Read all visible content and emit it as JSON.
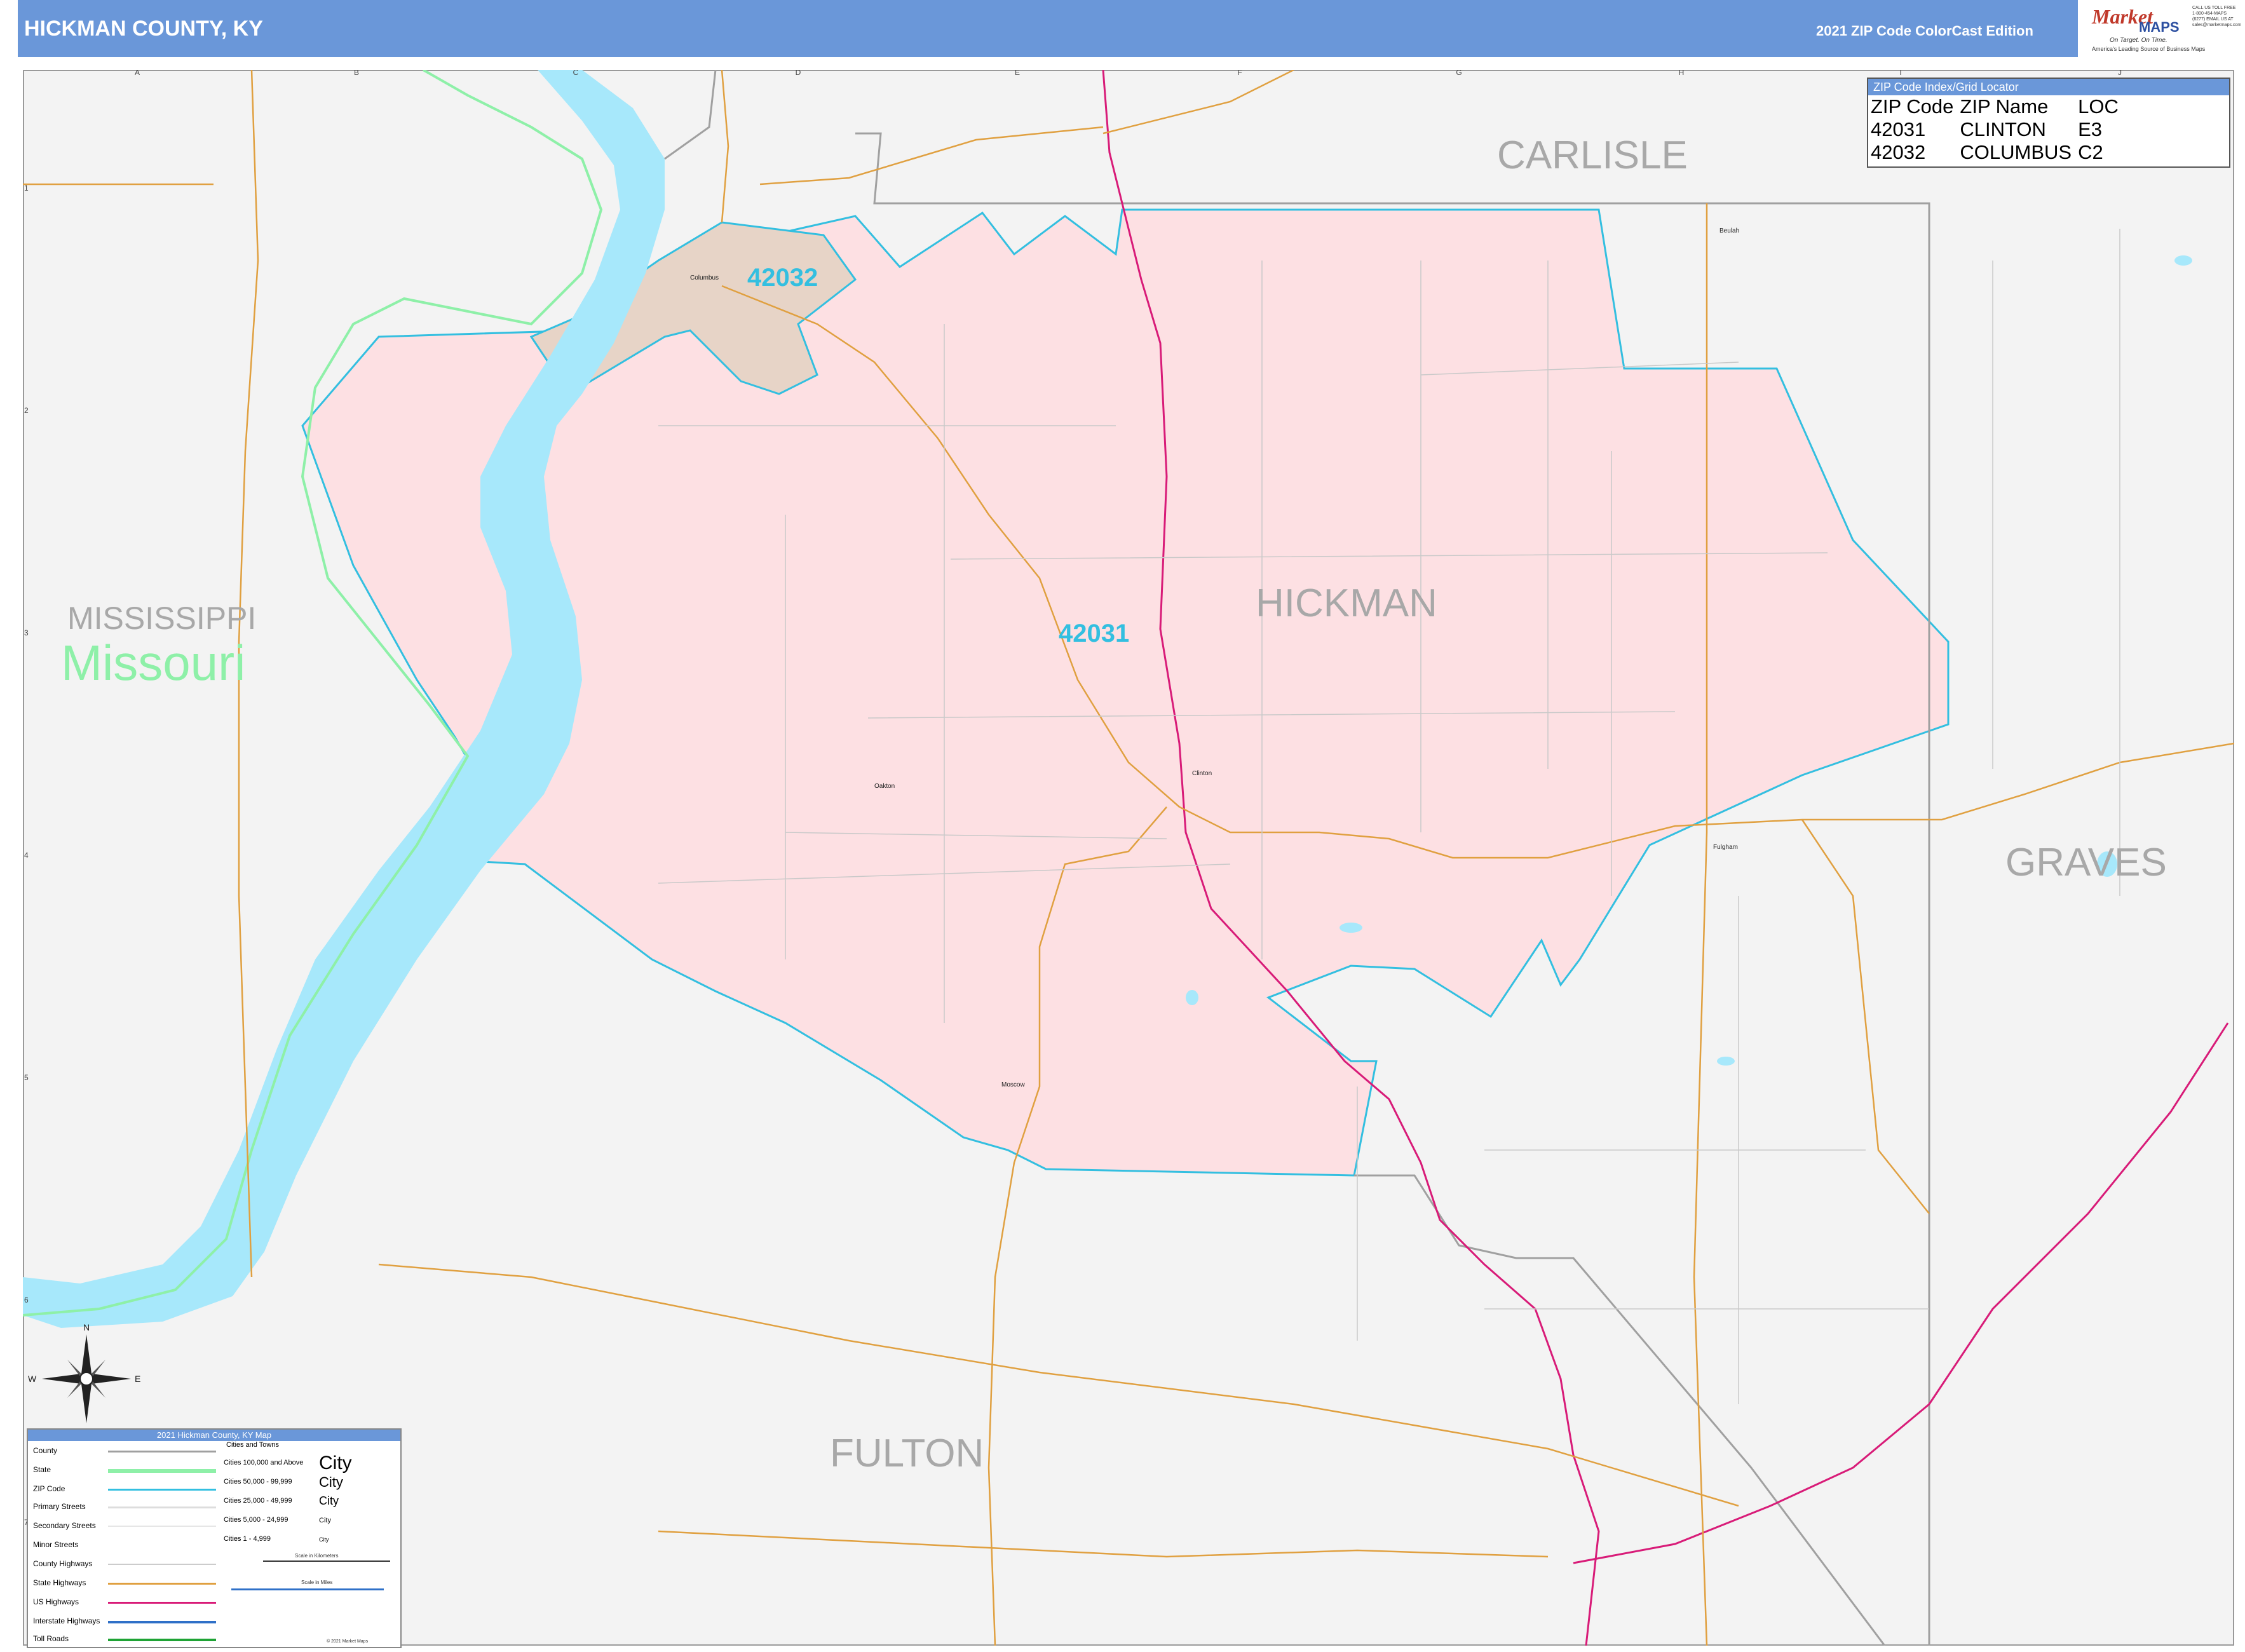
{
  "header": {
    "title": "HICKMAN COUNTY, KY",
    "edition": "2021 ZIP Code ColorCast Edition"
  },
  "logo": {
    "brand_part1": "Market",
    "brand_part2": "MAPS",
    "tagline1": "On Target. On Time.",
    "tagline2": "America's Leading Source of Business Maps",
    "contact": "CALL US TOLL FREE 1-800-454-MAPS (6277) EMAIL US AT sales@marketmaps.com"
  },
  "zip_index": {
    "title": "ZIP Code Index/Grid Locator",
    "headers": [
      "ZIP Code",
      "ZIP Name",
      "LOC"
    ],
    "rows": [
      [
        "42031",
        "CLINTON",
        "E3"
      ],
      [
        "42032",
        "COLUMBUS",
        "C2"
      ]
    ]
  },
  "grid": {
    "columns": [
      "A",
      "B",
      "C",
      "D",
      "E",
      "F",
      "G",
      "H",
      "I",
      "J"
    ],
    "rows": [
      "1",
      "2",
      "3",
      "4",
      "5",
      "6",
      "7"
    ]
  },
  "map_labels": {
    "counties": [
      "CARLISLE",
      "HICKMAN",
      "GRAVES",
      "FULTON"
    ],
    "state_left": "MISSISSIPPI",
    "state_missouri": "Missouri",
    "zip_codes": [
      "42032",
      "42031"
    ],
    "places": [
      "Columbus",
      "Clinton",
      "Oakton",
      "Fulgham",
      "Moscow",
      "Beulah"
    ]
  },
  "compass": {
    "n": "N",
    "s": "S",
    "e": "E",
    "w": "W"
  },
  "legend": {
    "title": "2021 Hickman County, KY Map",
    "items": [
      "County",
      "State",
      "ZIP Code",
      "Primary Streets",
      "Secondary Streets",
      "Minor Streets",
      "County Highways",
      "State Highways",
      "US Highways",
      "Interstate Highways",
      "Toll Roads"
    ],
    "cities_title": "Cities and Towns",
    "city_classes": [
      "Cities 100,000 and Above",
      "Cities 50,000 - 99,999",
      "Cities 25,000 - 49,999",
      "Cities 5,000 - 24,999",
      "Cities 1 - 4,999"
    ],
    "city_sample": "City",
    "scale_km": "Scale in Kilometers",
    "scale_mi": "Scale in Miles",
    "copyright": "© 2021 Market Maps"
  },
  "colors": {
    "header": "#6a97d9",
    "zip_42031": "#fde0e3",
    "zip_42032": "#e7d4c7",
    "zip_boundary": "#33bfe0",
    "river": "#a7e8fb",
    "state_line": "#8ef0a8",
    "us_highway": "#d81b78",
    "state_highway": "#e0a040",
    "county_line": "#a0a0a0"
  }
}
